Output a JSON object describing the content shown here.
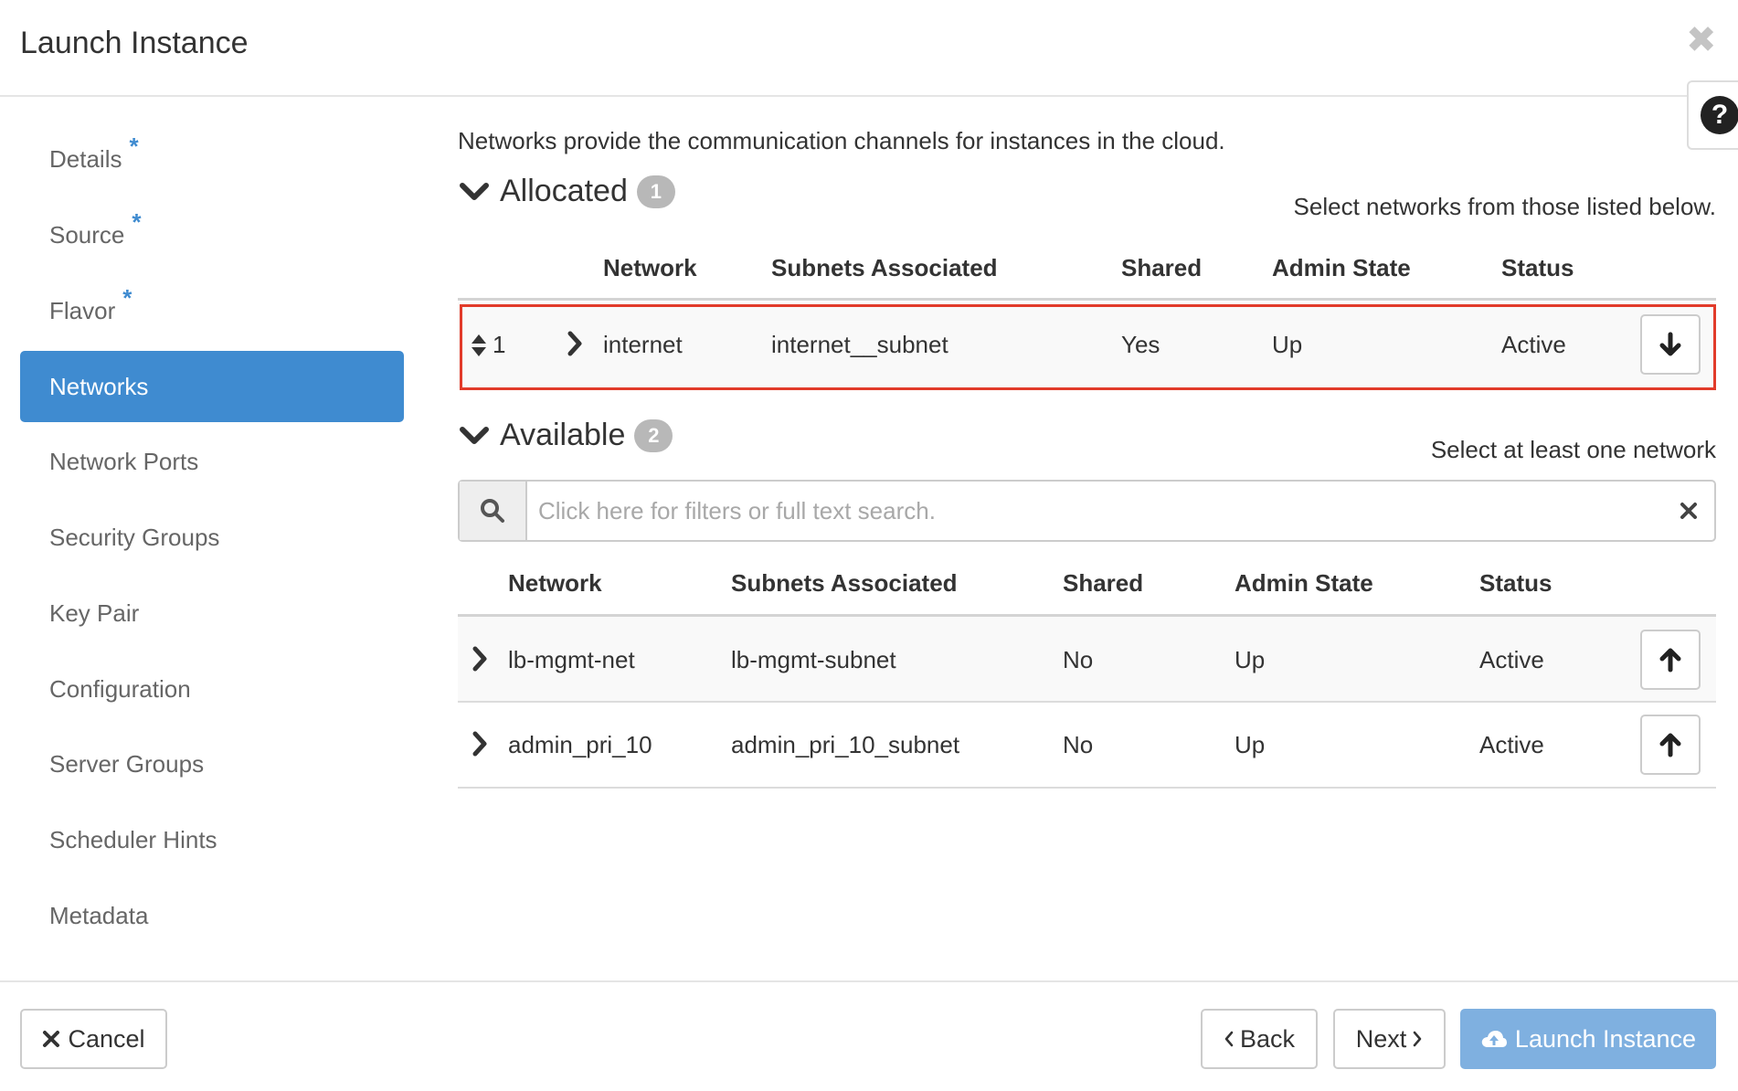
{
  "header": {
    "title": "Launch Instance",
    "close_glyph": "✖",
    "help_glyph": "?"
  },
  "sidebar": {
    "items": [
      {
        "label": "Details",
        "required": "*"
      },
      {
        "label": "Source",
        "required": "*"
      },
      {
        "label": "Flavor",
        "required": "*"
      },
      {
        "label": "Networks",
        "active": true
      },
      {
        "label": "Network Ports"
      },
      {
        "label": "Security Groups"
      },
      {
        "label": "Key Pair"
      },
      {
        "label": "Configuration"
      },
      {
        "label": "Server Groups"
      },
      {
        "label": "Scheduler Hints"
      },
      {
        "label": "Metadata"
      }
    ]
  },
  "main": {
    "description": "Networks provide the communication channels for instances in the cloud.",
    "allocated": {
      "title": "Allocated",
      "count": "1",
      "hint": "Select networks from those listed below.",
      "columns": [
        "Network",
        "Subnets Associated",
        "Shared",
        "Admin State",
        "Status"
      ],
      "rows": [
        {
          "order": "1",
          "network": "internet",
          "subnets": "internet__subnet",
          "shared": "Yes",
          "admin_state": "Up",
          "status": "Active"
        }
      ]
    },
    "available": {
      "title": "Available",
      "count": "2",
      "hint": "Select at least one network",
      "search_placeholder": "Click here for filters or full text search.",
      "columns": [
        "Network",
        "Subnets Associated",
        "Shared",
        "Admin State",
        "Status"
      ],
      "rows": [
        {
          "network": "lb-mgmt-net",
          "subnets": "lb-mgmt-subnet",
          "shared": "No",
          "admin_state": "Up",
          "status": "Active"
        },
        {
          "network": "admin_pri_10",
          "subnets": "admin_pri_10_subnet",
          "shared": "No",
          "admin_state": "Up",
          "status": "Active"
        }
      ]
    }
  },
  "footer": {
    "cancel_label": "Cancel",
    "back_label": "Back",
    "next_label": "Next",
    "launch_label": "Launch Instance"
  },
  "colors": {
    "accent": "#3f8bd0",
    "primary_button": "#7fb0e0",
    "highlight_border": "#e23b2a"
  }
}
